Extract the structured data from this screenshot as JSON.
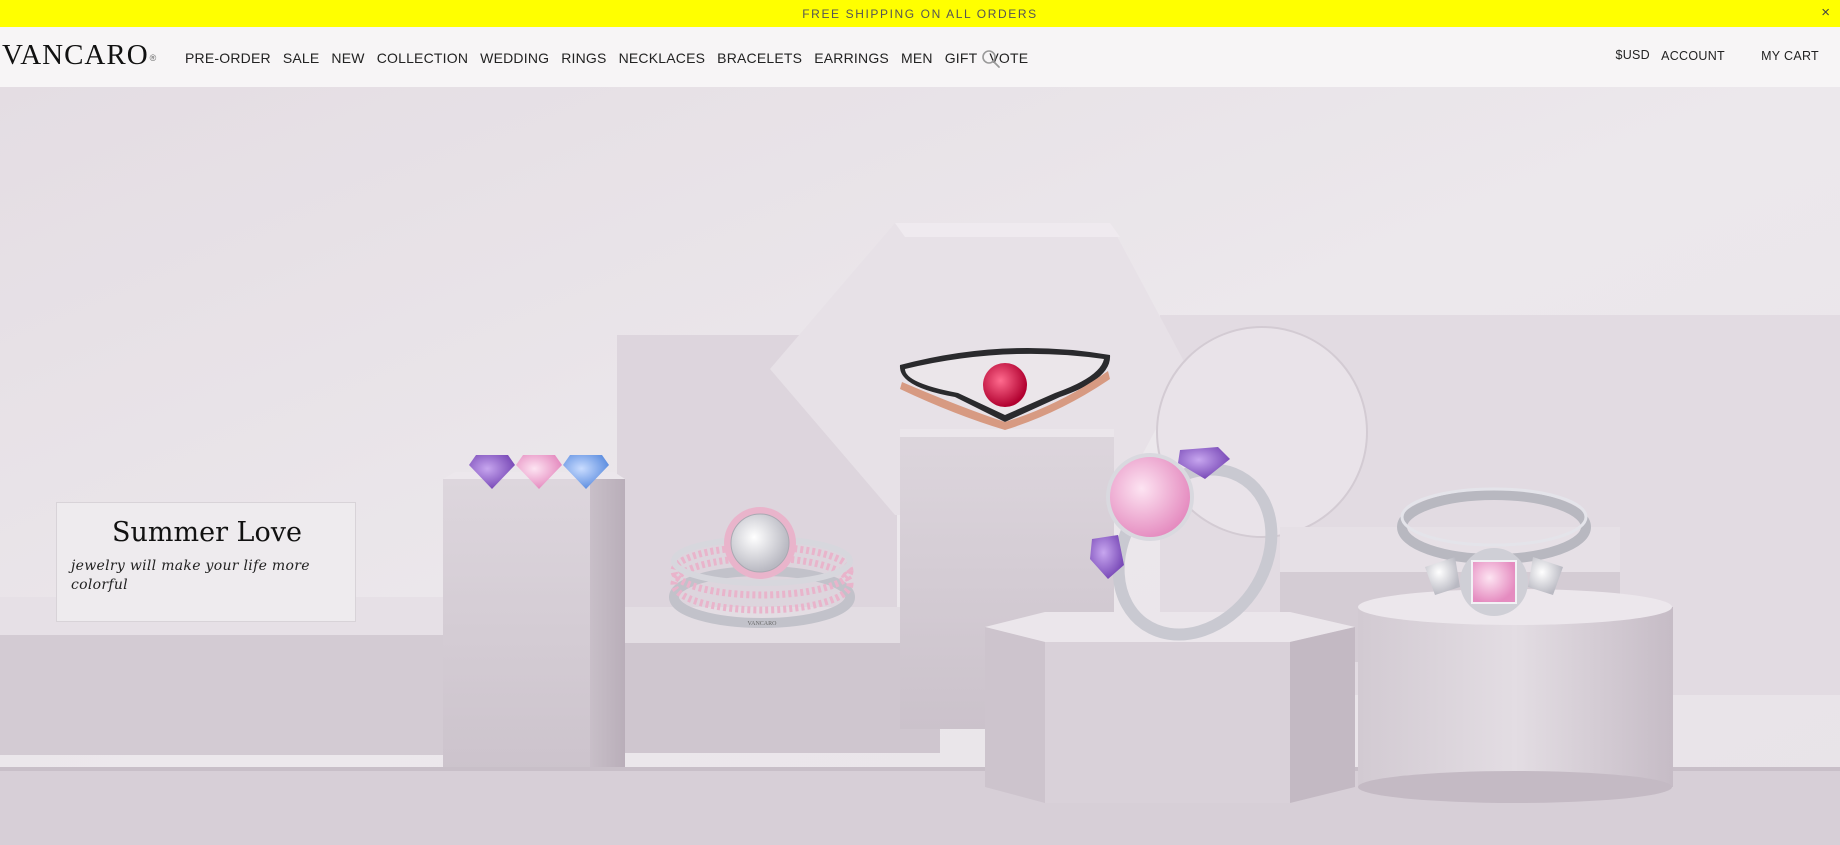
{
  "promo_bar": {
    "text": "FREE SHIPPING ON ALL ORDERS",
    "close": "×"
  },
  "header": {
    "logo": "VANCARO",
    "logo_mark": "®",
    "nav": [
      "PRE-ORDER",
      "SALE",
      "NEW",
      "COLLECTION",
      "WEDDING",
      "RINGS",
      "NECKLACES",
      "BRACELETS",
      "EARRINGS",
      "MEN",
      "GIFT",
      "VOTE"
    ],
    "search_icon": "search-icon",
    "currency": "$USD",
    "account": "ACCOUNT",
    "cart": "MY CART"
  },
  "hero": {
    "title": "Summer Love",
    "subtitle": "jewelry will make your life more colorful",
    "ring_engraving": "VANCARO"
  },
  "colors": {
    "promo_bar": "#ffff00",
    "header_bg": "#f7f5f6",
    "hero_bg": "#ebe6ea"
  }
}
